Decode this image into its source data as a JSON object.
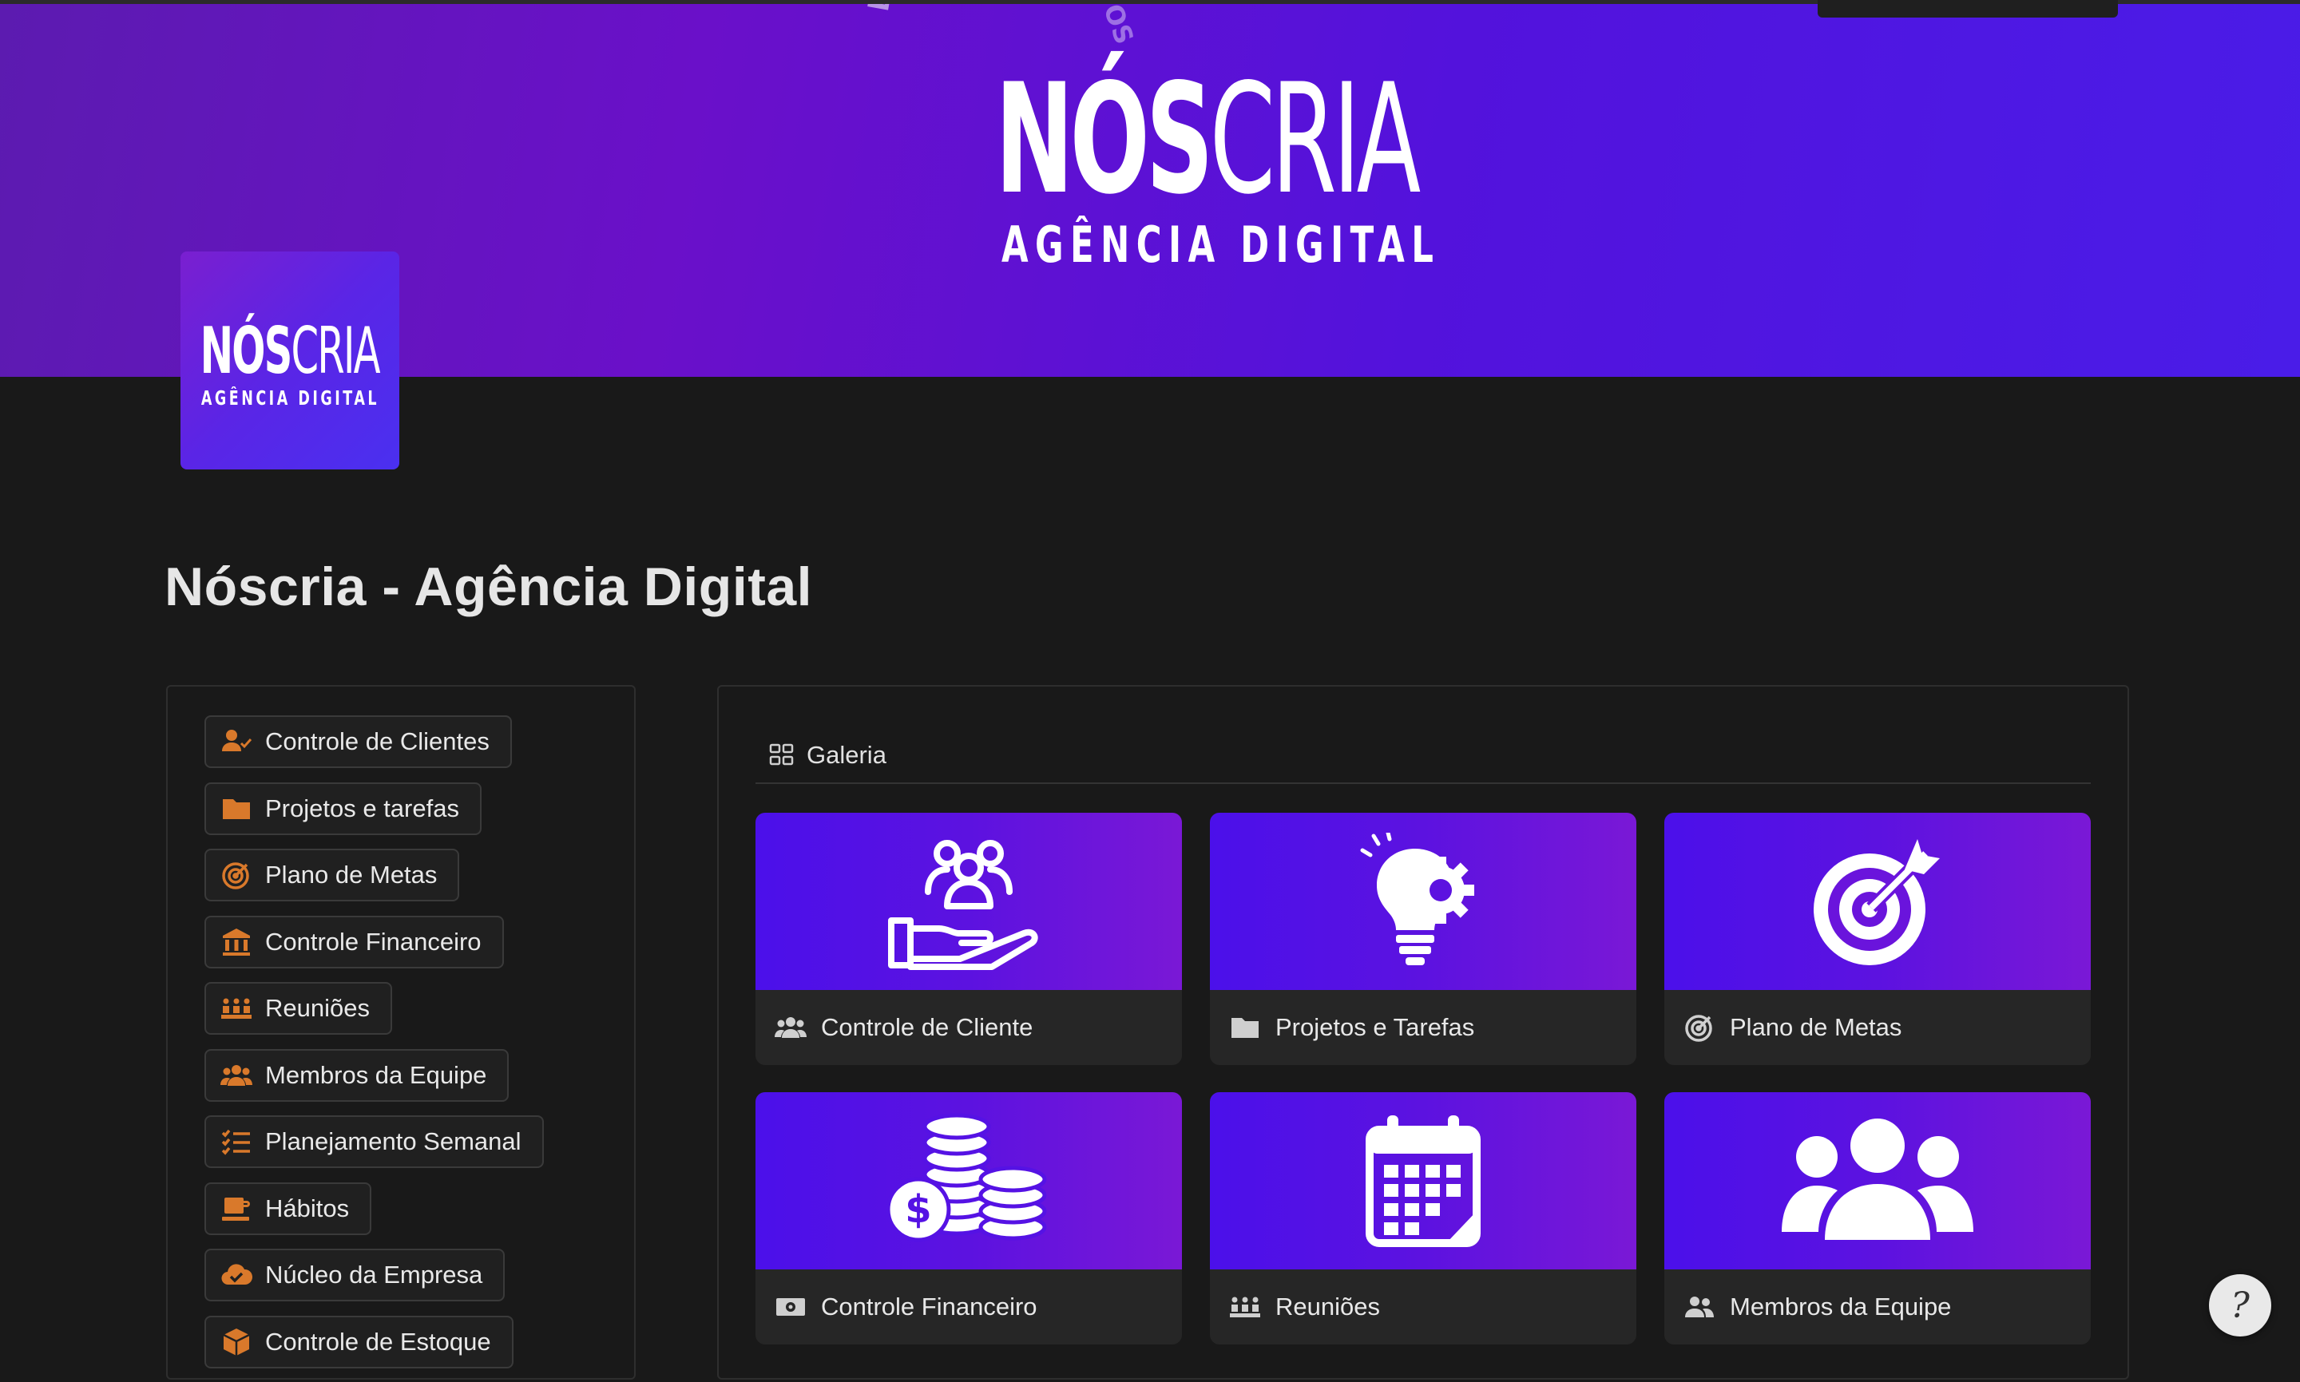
{
  "cover": {
    "brand_bold": "NÓS",
    "brand_thin": "CRIA",
    "subtitle": "AGÊNCIA DIGITAL",
    "arc_text": "DEIXA QUE NÓS C",
    "arc_text_2": "OS"
  },
  "page_icon": {
    "brand_bold": "NÓS",
    "brand_thin": "CRIA",
    "subtitle": "AGÊNCIA DIGITAL"
  },
  "page": {
    "title": "Nóscria - Agência Digital"
  },
  "nav": {
    "items": [
      {
        "label": "Controle de Clientes",
        "icon": "user-check-icon"
      },
      {
        "label": "Projetos e tarefas",
        "icon": "folder-icon"
      },
      {
        "label": "Plano de Metas",
        "icon": "target-icon"
      },
      {
        "label": "Controle Financeiro",
        "icon": "bank-icon"
      },
      {
        "label": "Reuniões",
        "icon": "meeting-icon"
      },
      {
        "label": "Membros da Equipe",
        "icon": "team-icon"
      },
      {
        "label": "Planejamento Semanal",
        "icon": "checklist-icon"
      },
      {
        "label": "Hábitos",
        "icon": "habit-icon"
      },
      {
        "label": "Núcleo da Empresa",
        "icon": "cloud-check-icon"
      },
      {
        "label": "Controle de Estoque",
        "icon": "box-icon"
      }
    ],
    "icon_color": "#d9792b"
  },
  "gallery": {
    "tab_label": "Galeria",
    "cards": [
      {
        "title": "Controle de Cliente",
        "icon": "client-hand-icon"
      },
      {
        "title": "Projetos e Tarefas",
        "icon": "lightbulb-gear-icon"
      },
      {
        "title": "Plano de Metas",
        "icon": "target-arrow-icon"
      },
      {
        "title": "Controle Financeiro",
        "icon": "coins-icon"
      },
      {
        "title": "Reuniões",
        "icon": "calendar-icon"
      },
      {
        "title": "Membros da Equipe",
        "icon": "group-icon"
      }
    ]
  },
  "help": {
    "icon": "notion-help-icon"
  }
}
